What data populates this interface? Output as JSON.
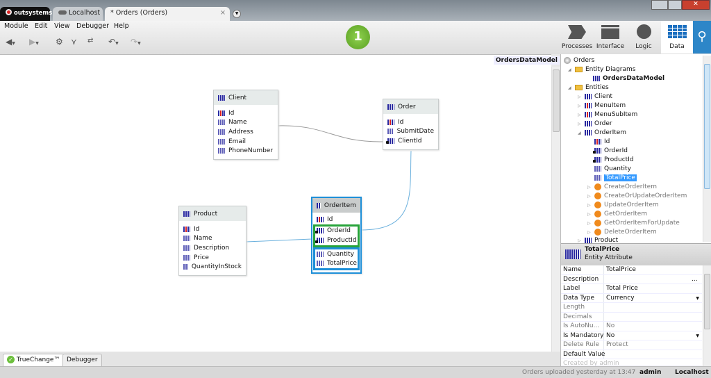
{
  "window": {
    "tabs": [
      {
        "label": "outsystems"
      },
      {
        "label": "Localhost"
      },
      {
        "label": "* Orders (Orders)"
      }
    ],
    "close_tab": "×"
  },
  "menu": [
    "Module",
    "Edit",
    "View",
    "Debugger",
    "Help"
  ],
  "step_badge": "1",
  "right_tabs": [
    {
      "label": "Processes"
    },
    {
      "label": "Interface"
    },
    {
      "label": "Logic"
    },
    {
      "label": "Data",
      "selected": true
    }
  ],
  "canvas": {
    "diagram_name": "OrdersDataModel",
    "entities": {
      "client": {
        "name": "Client",
        "attrs": [
          "Id",
          "Name",
          "Address",
          "Email",
          "PhoneNumber"
        ]
      },
      "order": {
        "name": "Order",
        "attrs": [
          "Id",
          "SubmitDate",
          "ClientId"
        ]
      },
      "product": {
        "name": "Product",
        "attrs": [
          "Id",
          "Name",
          "Description",
          "Price",
          "QuantityInStock"
        ]
      },
      "orderitem": {
        "name": "OrderItem",
        "attrs": [
          "Id",
          "OrderId",
          "ProductId",
          "Quantity",
          "TotalPrice"
        ]
      }
    }
  },
  "tree": {
    "root": "Orders",
    "diagrams": "Entity Diagrams",
    "diagram": "OrdersDataModel",
    "entities": "Entities",
    "items": [
      "Client",
      "MenuItem",
      "MenuSubItem",
      "Order",
      "OrderItem"
    ],
    "orderitem_attrs": [
      "Id",
      "OrderId",
      "ProductId",
      "Quantity",
      "TotalPrice"
    ],
    "actions": [
      "CreateOrderItem",
      "CreateOrUpdateOrderItem",
      "UpdateOrderItem",
      "GetOrderItem",
      "GetOrderItemForUpdate",
      "DeleteOrderItem"
    ],
    "last": "Product",
    "selected": "TotalPrice"
  },
  "props": {
    "title": "TotalPrice",
    "subtitle": "Entity Attribute",
    "rows": [
      {
        "k": "Name",
        "v": "TotalPrice"
      },
      {
        "k": "Description",
        "v": "..."
      },
      {
        "k": "Label",
        "v": "Total Price"
      },
      {
        "k": "Data Type",
        "v": "Currency"
      },
      {
        "k": "Length",
        "v": ""
      },
      {
        "k": "Decimals",
        "v": ""
      },
      {
        "k": "Is AutoNu...",
        "v": "No"
      },
      {
        "k": "Is Mandatory",
        "v": "No"
      },
      {
        "k": "Delete Rule",
        "v": "Protect"
      },
      {
        "k": "Default Value",
        "v": ""
      },
      {
        "k": "Created by admin",
        "v": ""
      }
    ]
  },
  "bottom_tabs": [
    "TrueChange™",
    "Debugger"
  ],
  "status": {
    "message": "Orders uploaded yesterday at 13:47",
    "user": "admin",
    "server": "Localhost"
  }
}
